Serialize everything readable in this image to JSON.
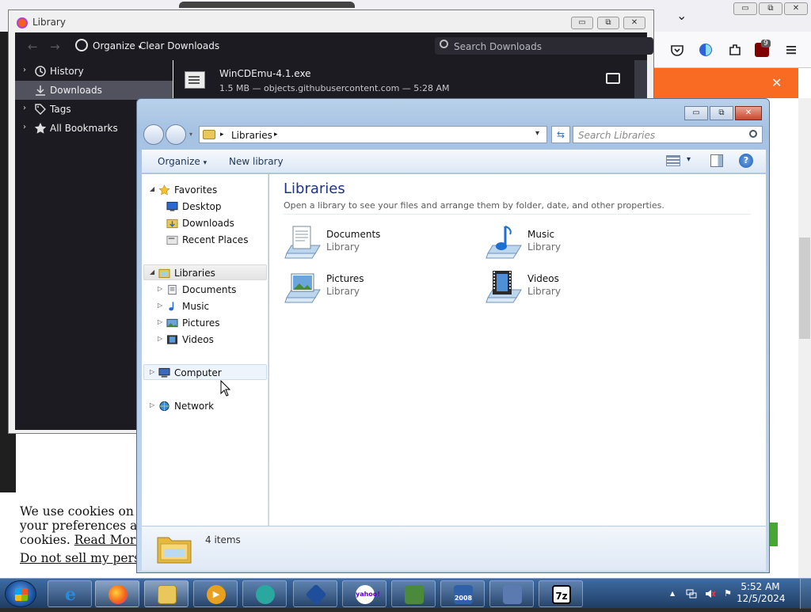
{
  "firefox": {
    "window_controls": {
      "minimize": "▭",
      "restore": "⧉",
      "close": "✕"
    },
    "menu_chevron": "⌄",
    "extension_badge": "9",
    "banner_close": "✕",
    "cookie_banner": {
      "line1": "We use cookies on ou",
      "line2": "your preferences and",
      "line3_prefix": "cookies.",
      "read_more": "Read More",
      "do_not_sell": "Do not sell my perso"
    }
  },
  "library_window": {
    "title": "Library",
    "controls": {
      "minimize": "▭",
      "restore": "⧉",
      "close": "✕"
    },
    "toolbar": {
      "back": "←",
      "forward": "→",
      "organize": "Organize",
      "organize_caret": "▾",
      "clear_downloads": "Clear Downloads",
      "search_placeholder": "Search Downloads"
    },
    "sidebar": [
      {
        "label": "History",
        "arrow": "›",
        "icon": "history-icon",
        "selected": false
      },
      {
        "label": "Downloads",
        "arrow": "",
        "icon": "download-icon",
        "selected": true
      },
      {
        "label": "Tags",
        "arrow": "›",
        "icon": "tag-icon",
        "selected": false
      },
      {
        "label": "All Bookmarks",
        "arrow": "›",
        "icon": "star-icon",
        "selected": false
      }
    ],
    "download": {
      "name": "WinCDEmu-4.1.exe",
      "meta": "1.5 MB — objects.githubusercontent.com — 5:28 AM"
    }
  },
  "explorer": {
    "address": {
      "root_arrow": "▸",
      "crumb": "Libraries",
      "crumb_arrow": "▸"
    },
    "search_placeholder": "Search Libraries",
    "commands": {
      "organize": "Organize",
      "organize_caret": "▾",
      "new_library": "New library",
      "views_caret": "▾",
      "help": "?"
    },
    "nav": {
      "favorites": {
        "label": "Favorites",
        "items": [
          "Desktop",
          "Downloads",
          "Recent Places"
        ]
      },
      "libraries": {
        "label": "Libraries",
        "items": [
          "Documents",
          "Music",
          "Pictures",
          "Videos"
        ]
      },
      "computer": "Computer",
      "network": "Network"
    },
    "content": {
      "title": "Libraries",
      "subtitle": "Open a library to see your files and arrange them by folder, date, and other properties.",
      "libraries": [
        {
          "name": "Documents",
          "type": "Library",
          "icon": "documents-library-icon"
        },
        {
          "name": "Music",
          "type": "Library",
          "icon": "music-library-icon"
        },
        {
          "name": "Pictures",
          "type": "Library",
          "icon": "pictures-library-icon"
        },
        {
          "name": "Videos",
          "type": "Library",
          "icon": "videos-library-icon"
        }
      ]
    },
    "details": {
      "count": "4 items"
    }
  },
  "taskbar": {
    "apps": [
      {
        "name": "internet-explorer",
        "glyph": "e",
        "color": "#2a8ad8",
        "active": false
      },
      {
        "name": "firefox",
        "glyph": "",
        "color": "#f45f1c",
        "active": true
      },
      {
        "name": "windows-explorer",
        "glyph": "",
        "color": "#e9c75a",
        "active": true
      },
      {
        "name": "media-player",
        "glyph": "▶",
        "color": "#e8a020",
        "active": false
      },
      {
        "name": "vm-app",
        "glyph": "",
        "color": "#2aa8a0",
        "active": false
      },
      {
        "name": "virtualbox",
        "glyph": "",
        "color": "#1f4f9a",
        "active": false
      },
      {
        "name": "yahoo",
        "glyph": "yahoo!",
        "color": "#ffffff",
        "active": false
      },
      {
        "name": "device-manager",
        "glyph": "",
        "color": "#4a8a3a",
        "active": false
      },
      {
        "name": "server-2008",
        "glyph": "2008",
        "color": "#3060a8",
        "active": false
      },
      {
        "name": "network-app",
        "glyph": "",
        "color": "#5a7ab0",
        "active": false
      },
      {
        "name": "7zip",
        "glyph": "7z",
        "color": "#ffffff",
        "active": false
      }
    ],
    "tray": {
      "up_arrow": "▲",
      "flag": "⚑"
    },
    "clock": {
      "time": "5:52 AM",
      "date": "12/5/2024"
    }
  }
}
